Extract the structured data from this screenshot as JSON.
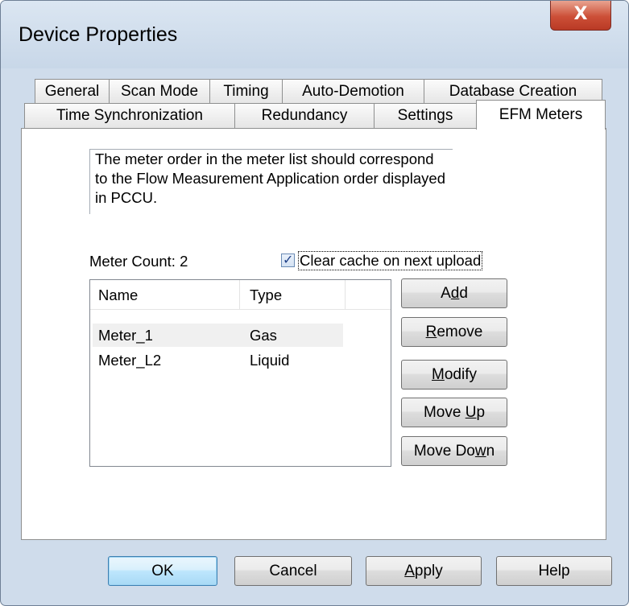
{
  "window": {
    "title": "Device Properties",
    "close_glyph": "X"
  },
  "tabs": {
    "row1": [
      "General",
      "Scan Mode",
      "Timing",
      "Auto-Demotion",
      "Database Creation"
    ],
    "row2": [
      "Time Synchronization",
      "Redundancy",
      "Settings",
      "EFM Meters"
    ],
    "active": "EFM Meters"
  },
  "panel": {
    "info_text": "The meter order in the meter list should correspond to the Flow Measurement Application order displayed in PCCU.",
    "meter_count_label": "Meter Count: 2",
    "clear_cache": {
      "label": "Clear cache on next upload",
      "checked": true,
      "check_glyph": "✓"
    },
    "list": {
      "columns": [
        "Name",
        "Type"
      ],
      "rows": [
        {
          "name": "Meter_1",
          "type": "Gas",
          "selected": true
        },
        {
          "name": "Meter_L2",
          "type": "Liquid",
          "selected": false
        }
      ]
    },
    "side_buttons": [
      {
        "before": "A",
        "key": "d",
        "after": "d"
      },
      {
        "before": "",
        "key": "R",
        "after": "emove"
      },
      {
        "before": "",
        "key": "M",
        "after": "odify"
      },
      {
        "before": "Move ",
        "key": "U",
        "after": "p"
      },
      {
        "before": "Move Do",
        "key": "w",
        "after": "n"
      }
    ]
  },
  "footer_buttons": [
    {
      "before": "OK",
      "key": "",
      "after": ""
    },
    {
      "before": "Cancel",
      "key": "",
      "after": ""
    },
    {
      "before": "",
      "key": "A",
      "after": "pply"
    },
    {
      "before": "Help",
      "key": "",
      "after": ""
    }
  ],
  "colors": {
    "accent_border": "#3c7fb1",
    "close_red": "#cc4f37",
    "frame": "#cfdceb"
  }
}
